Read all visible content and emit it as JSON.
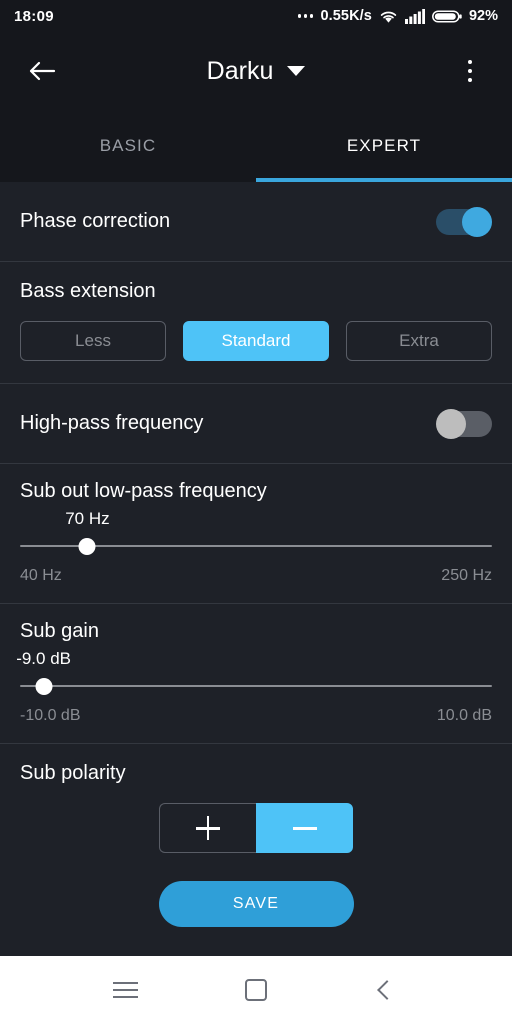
{
  "status_bar": {
    "clock": "18:09",
    "net_speed": "0.55K/s",
    "battery_percent": "92%",
    "icons": [
      "more-dots-icon",
      "wifi-icon",
      "cellular-signal-icon",
      "battery-icon"
    ]
  },
  "app_bar": {
    "back_icon": "back-arrow-icon",
    "title": "Darku",
    "dropdown_icon": "chevron-down-icon",
    "overflow_icon": "more-vertical-icon"
  },
  "tabs": {
    "items": [
      {
        "label": "BASIC",
        "active": false
      },
      {
        "label": "EXPERT",
        "active": true
      }
    ],
    "active_index": 1,
    "indicator_color": "#3aa6dd"
  },
  "settings": {
    "phase_correction": {
      "label": "Phase correction",
      "state": "on"
    },
    "bass_extension": {
      "label": "Bass extension",
      "options": [
        "Less",
        "Standard",
        "Extra"
      ],
      "selected": "Standard"
    },
    "high_pass_frequency": {
      "label": "High-pass frequency",
      "state": "off"
    },
    "sub_out_low_pass": {
      "label": "Sub out low-pass frequency",
      "value": "70 Hz",
      "min_label": "40 Hz",
      "max_label": "250 Hz",
      "min": 40,
      "max": 250,
      "current": 70
    },
    "sub_gain": {
      "label": "Sub gain",
      "value": "-9.0 dB",
      "min_label": "-10.0 dB",
      "max_label": "10.0 dB",
      "min": -10,
      "max": 10,
      "current": -9
    },
    "sub_polarity": {
      "label": "Sub polarity",
      "options": [
        "+",
        "−"
      ],
      "selected": "−"
    }
  },
  "save_button": {
    "label": "SAVE"
  },
  "nav_bar": {
    "items": [
      {
        "icon": "menu-recents-icon"
      },
      {
        "icon": "home-square-icon"
      },
      {
        "icon": "back-chevron-icon"
      }
    ]
  },
  "colors": {
    "accent": "#4ec3f7",
    "accent_dark": "#2f9fd8",
    "background": "#1e2128",
    "bar_background": "#15171c",
    "divider": "#33373f",
    "muted_text": "#8a8d93"
  }
}
